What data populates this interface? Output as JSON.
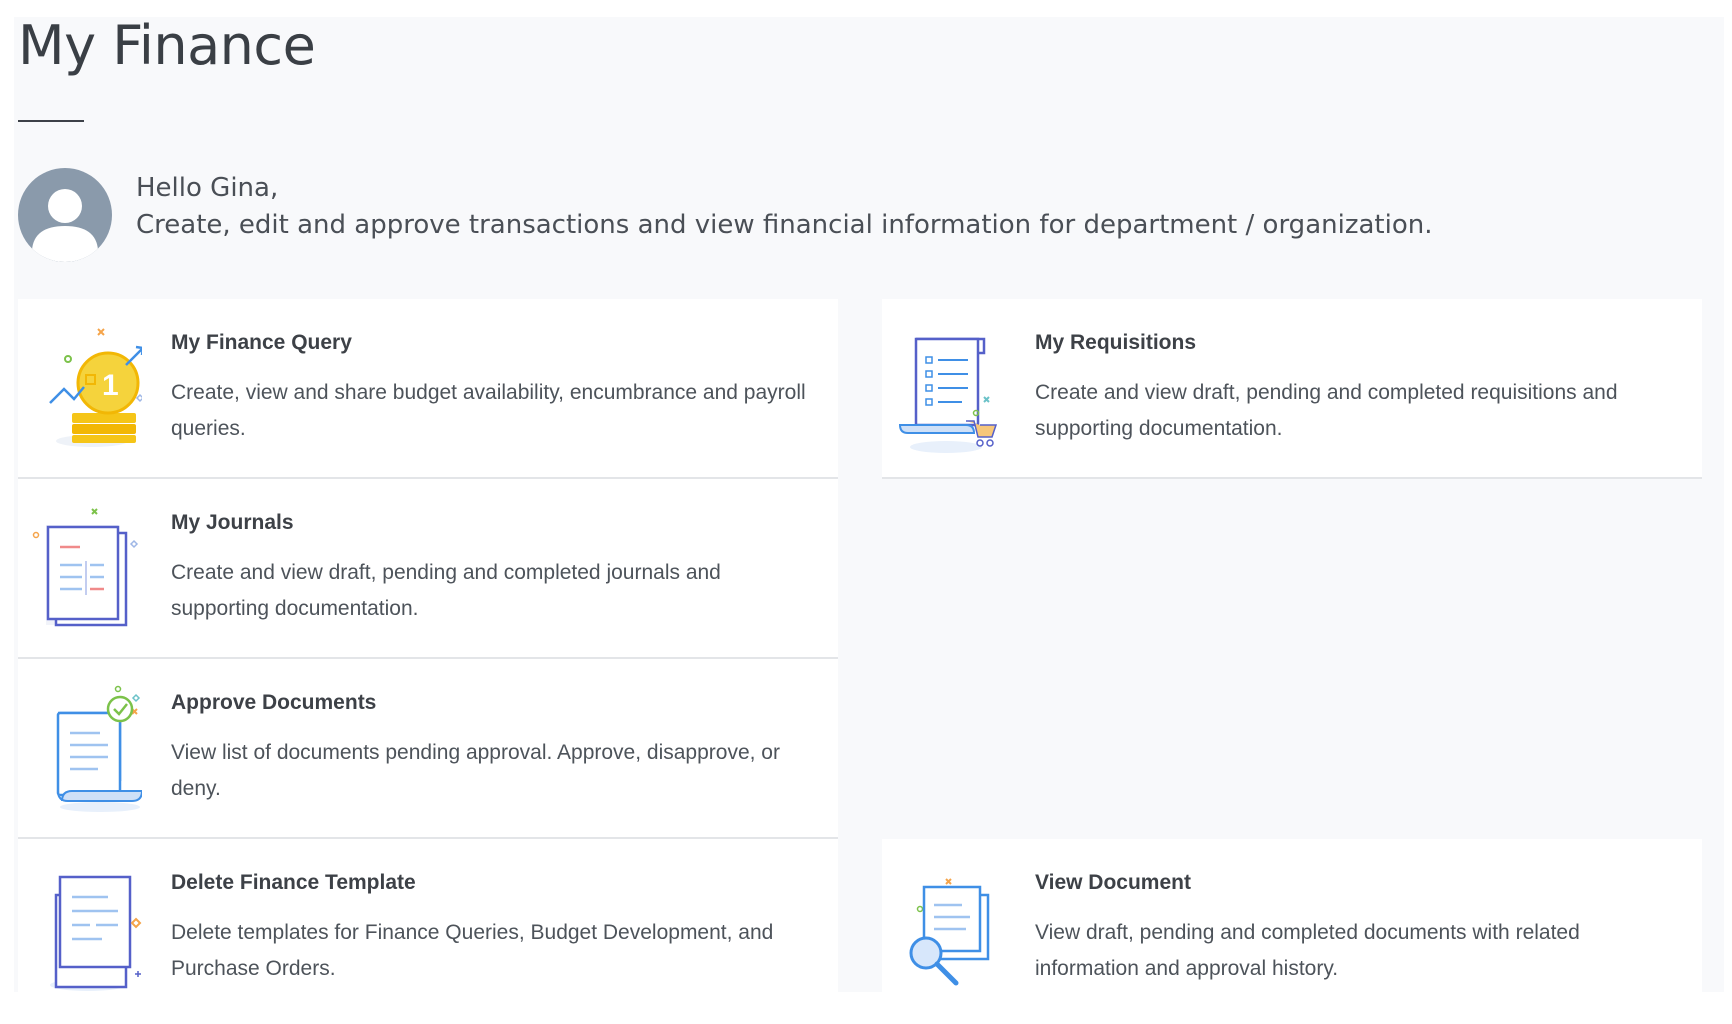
{
  "header": {
    "title": "My Finance"
  },
  "welcome": {
    "greeting": "Hello Gina,",
    "message": "Create, edit and approve transactions and view financial information for department / organization."
  },
  "cards": [
    {
      "title": "My Finance Query",
      "description": "Create, view and share budget availability, encumbrance and payroll queries.",
      "icon": "coins-chart-icon"
    },
    {
      "title": "My Requisitions",
      "description": "Create and view draft, pending and completed requisitions and supporting documentation.",
      "icon": "requisition-scroll-icon"
    },
    {
      "title": "My Journals",
      "description": "Create and view draft, pending and completed journals and supporting documentation.",
      "icon": "journal-pages-icon"
    },
    {
      "title": "Approve Documents",
      "description": "View list of documents pending approval. Approve, disapprove, or deny.",
      "icon": "approved-document-icon"
    },
    {
      "title": "Delete Finance Template",
      "description": "Delete templates for Finance Queries, Budget Development, and Purchase Orders.",
      "icon": "finance-template-icon"
    },
    {
      "title": "View Document",
      "description": "View draft, pending and completed documents with related information and approval history.",
      "icon": "document-search-icon"
    }
  ],
  "colors": {
    "page_background": "#f8f9fb",
    "card_background": "#ffffff",
    "divider": "#e3e5e8",
    "avatar": "#8a9aab",
    "icon_blue": "#3f8fe6",
    "icon_indigo": "#5560c9",
    "icon_gold": "#f5c518"
  }
}
